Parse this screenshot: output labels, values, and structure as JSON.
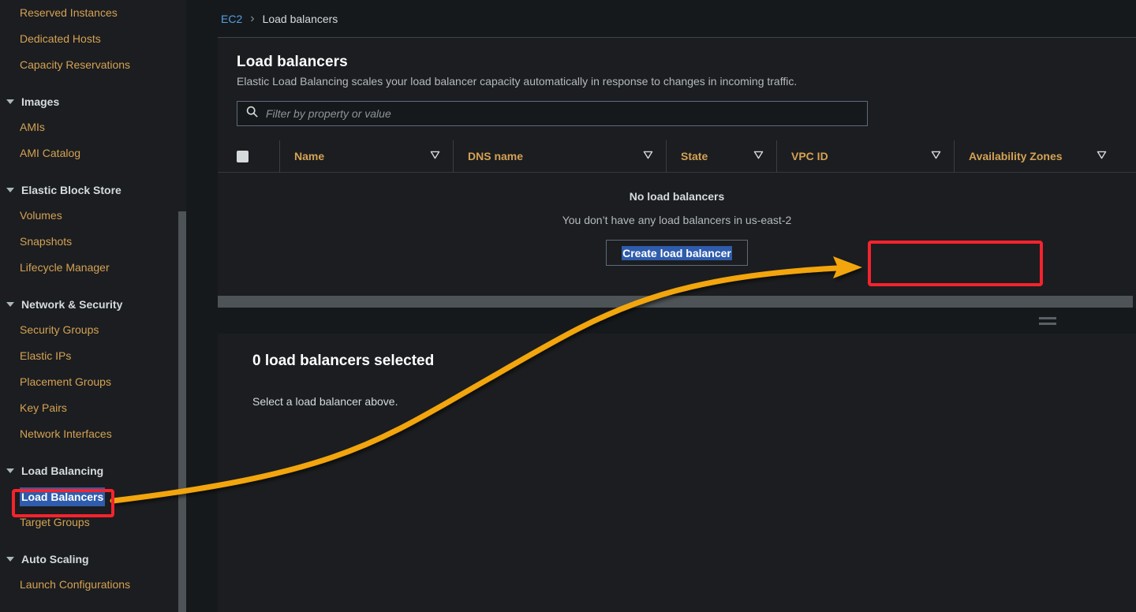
{
  "sidebar": {
    "items": [
      {
        "type": "link",
        "label": "Reserved Instances"
      },
      {
        "type": "link",
        "label": "Dedicated Hosts"
      },
      {
        "type": "link",
        "label": "Capacity Reservations"
      },
      {
        "type": "group",
        "label": "Images"
      },
      {
        "type": "link",
        "label": "AMIs"
      },
      {
        "type": "link",
        "label": "AMI Catalog"
      },
      {
        "type": "group",
        "label": "Elastic Block Store"
      },
      {
        "type": "link",
        "label": "Volumes"
      },
      {
        "type": "link",
        "label": "Snapshots"
      },
      {
        "type": "link",
        "label": "Lifecycle Manager"
      },
      {
        "type": "group",
        "label": "Network & Security"
      },
      {
        "type": "link",
        "label": "Security Groups"
      },
      {
        "type": "link",
        "label": "Elastic IPs"
      },
      {
        "type": "link",
        "label": "Placement Groups"
      },
      {
        "type": "link",
        "label": "Key Pairs"
      },
      {
        "type": "link",
        "label": "Network Interfaces"
      },
      {
        "type": "group",
        "label": "Load Balancing"
      },
      {
        "type": "selected",
        "label": "Load Balancers"
      },
      {
        "type": "link",
        "label": "Target Groups"
      },
      {
        "type": "group",
        "label": "Auto Scaling"
      },
      {
        "type": "link",
        "label": "Launch Configurations"
      }
    ]
  },
  "breadcrumb": {
    "root": "EC2",
    "separator": "›",
    "current": "Load balancers"
  },
  "panel": {
    "title": "Load balancers",
    "description": "Elastic Load Balancing scales your load balancer capacity automatically in response to changes in incoming traffic.",
    "filter_placeholder": "Filter by property or value",
    "filter_value": "",
    "columns": [
      {
        "label": "Name"
      },
      {
        "label": "DNS name"
      },
      {
        "label": "State"
      },
      {
        "label": "VPC ID"
      },
      {
        "label": "Availability Zones"
      }
    ],
    "empty": {
      "title": "No load balancers",
      "subtitle": "You don’t have any load balancers in us-east-2",
      "button_label": "Create load balancer"
    }
  },
  "detail": {
    "title": "0 load balancers selected",
    "subtitle": "Select a load balancer above."
  },
  "colors": {
    "accent_link": "#539fe5",
    "nav_link": "#d5a253",
    "selection_blue": "#2f5cac",
    "annotation_red": "#f5232d",
    "annotation_arrow": "#f2a50c",
    "panel_bg": "#1b1d20",
    "page_bg": "#16191c"
  }
}
